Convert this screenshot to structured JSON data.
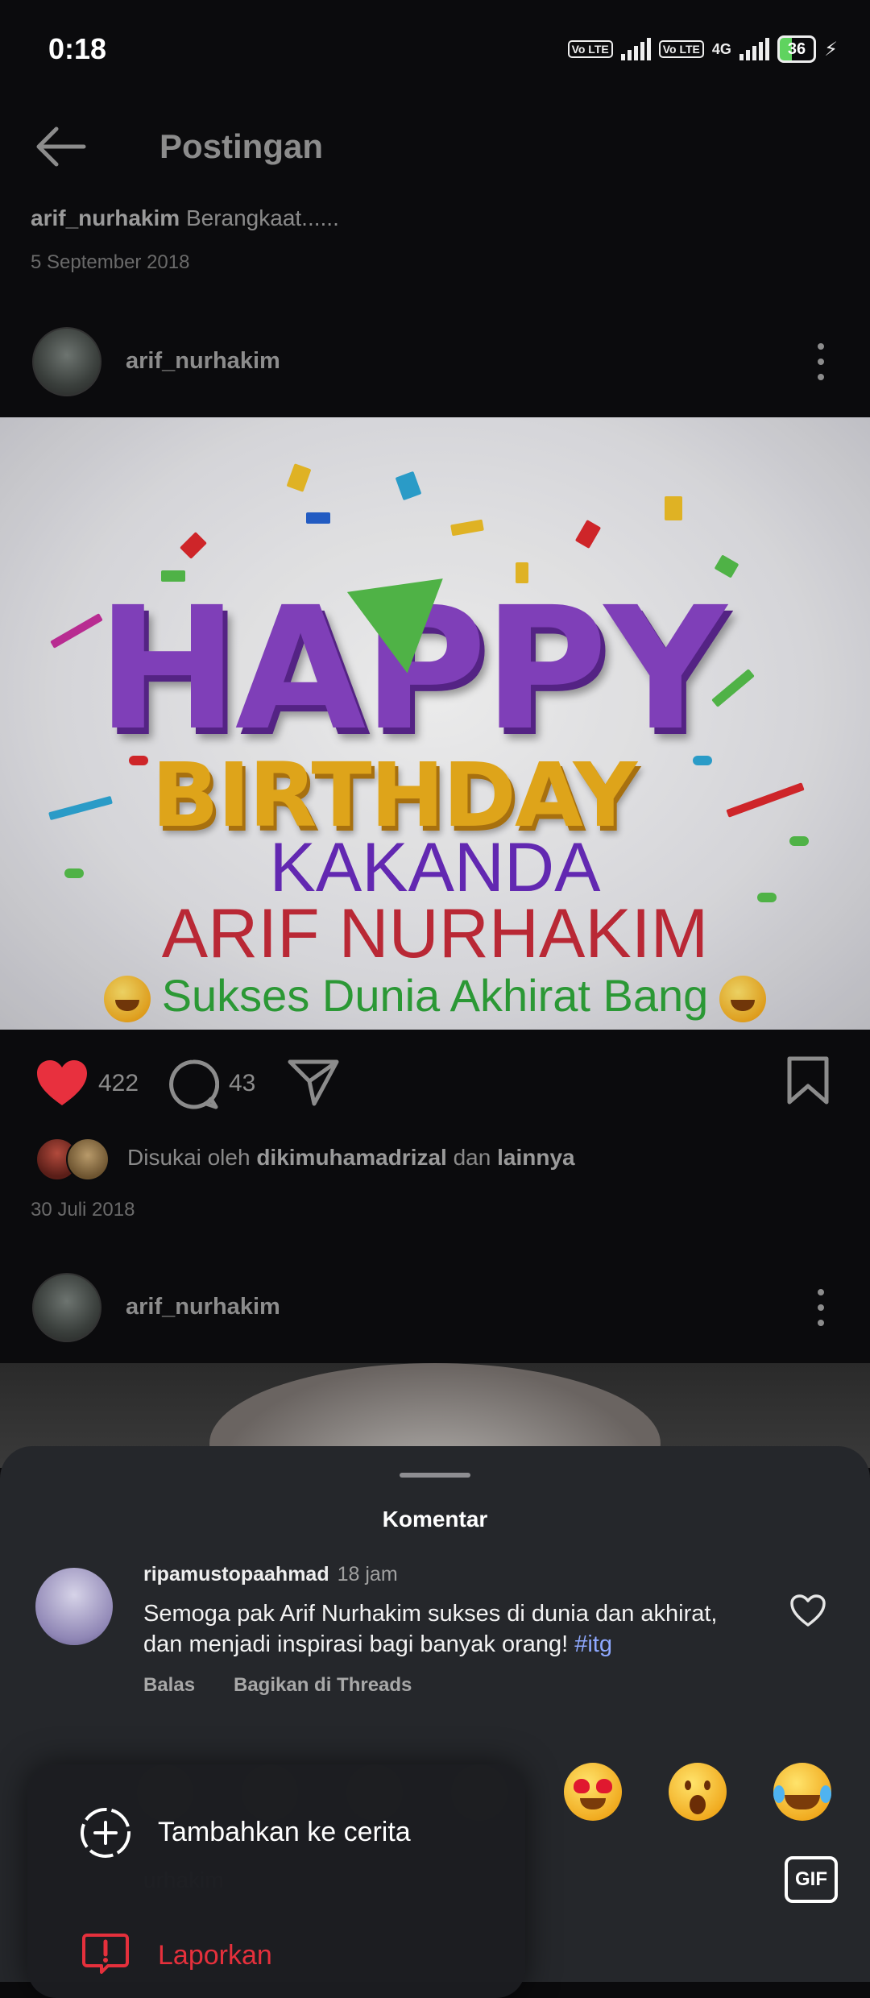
{
  "status_bar": {
    "time": "0:18",
    "volte1": "Vo LTE",
    "volte2": "Vo LTE",
    "network": "4G",
    "battery": "36"
  },
  "header": {
    "title": "Postingan"
  },
  "prev_post": {
    "username": "arif_nurhakim",
    "caption": "Berangkaat......",
    "date": "5 September 2018"
  },
  "post": {
    "username": "arif_nurhakim",
    "image_text": {
      "line1": "HAPPY",
      "line2": "BIRTHDAY",
      "line3": "KAKANDA",
      "line4": "ARIF NURHAKIM",
      "line5": "Sukses Dunia Akhirat Bang"
    },
    "likes": "422",
    "comments": "43",
    "liked_by_prefix": "Disukai oleh",
    "liked_by_user": "dikimuhamadrizal",
    "liked_by_and": "dan",
    "liked_by_others": "lainnya",
    "date": "30 Juli 2018"
  },
  "next_post": {
    "username": "arif_nurhakim"
  },
  "comments_sheet": {
    "title": "Komentar",
    "comment": {
      "username": "ripamustopaahmad",
      "time": "18 jam",
      "text": "Semoga pak Arif Nurhakim sukses di dunia dan akhirat, dan menjadi inspirasi bagi banyak orang! ",
      "hashtag": "#itg",
      "reply_label": "Balas",
      "share_label": "Bagikan di Threads"
    },
    "input_placeholder": "urhakim",
    "gif_label": "GIF"
  },
  "popup_menu": {
    "add_story_label": "Tambahkan ke cerita",
    "report_label": "Laporkan"
  },
  "colors": {
    "like_red": "#e8303e",
    "report_red": "#e5303c",
    "hashtag_blue": "#8ea8ff"
  }
}
